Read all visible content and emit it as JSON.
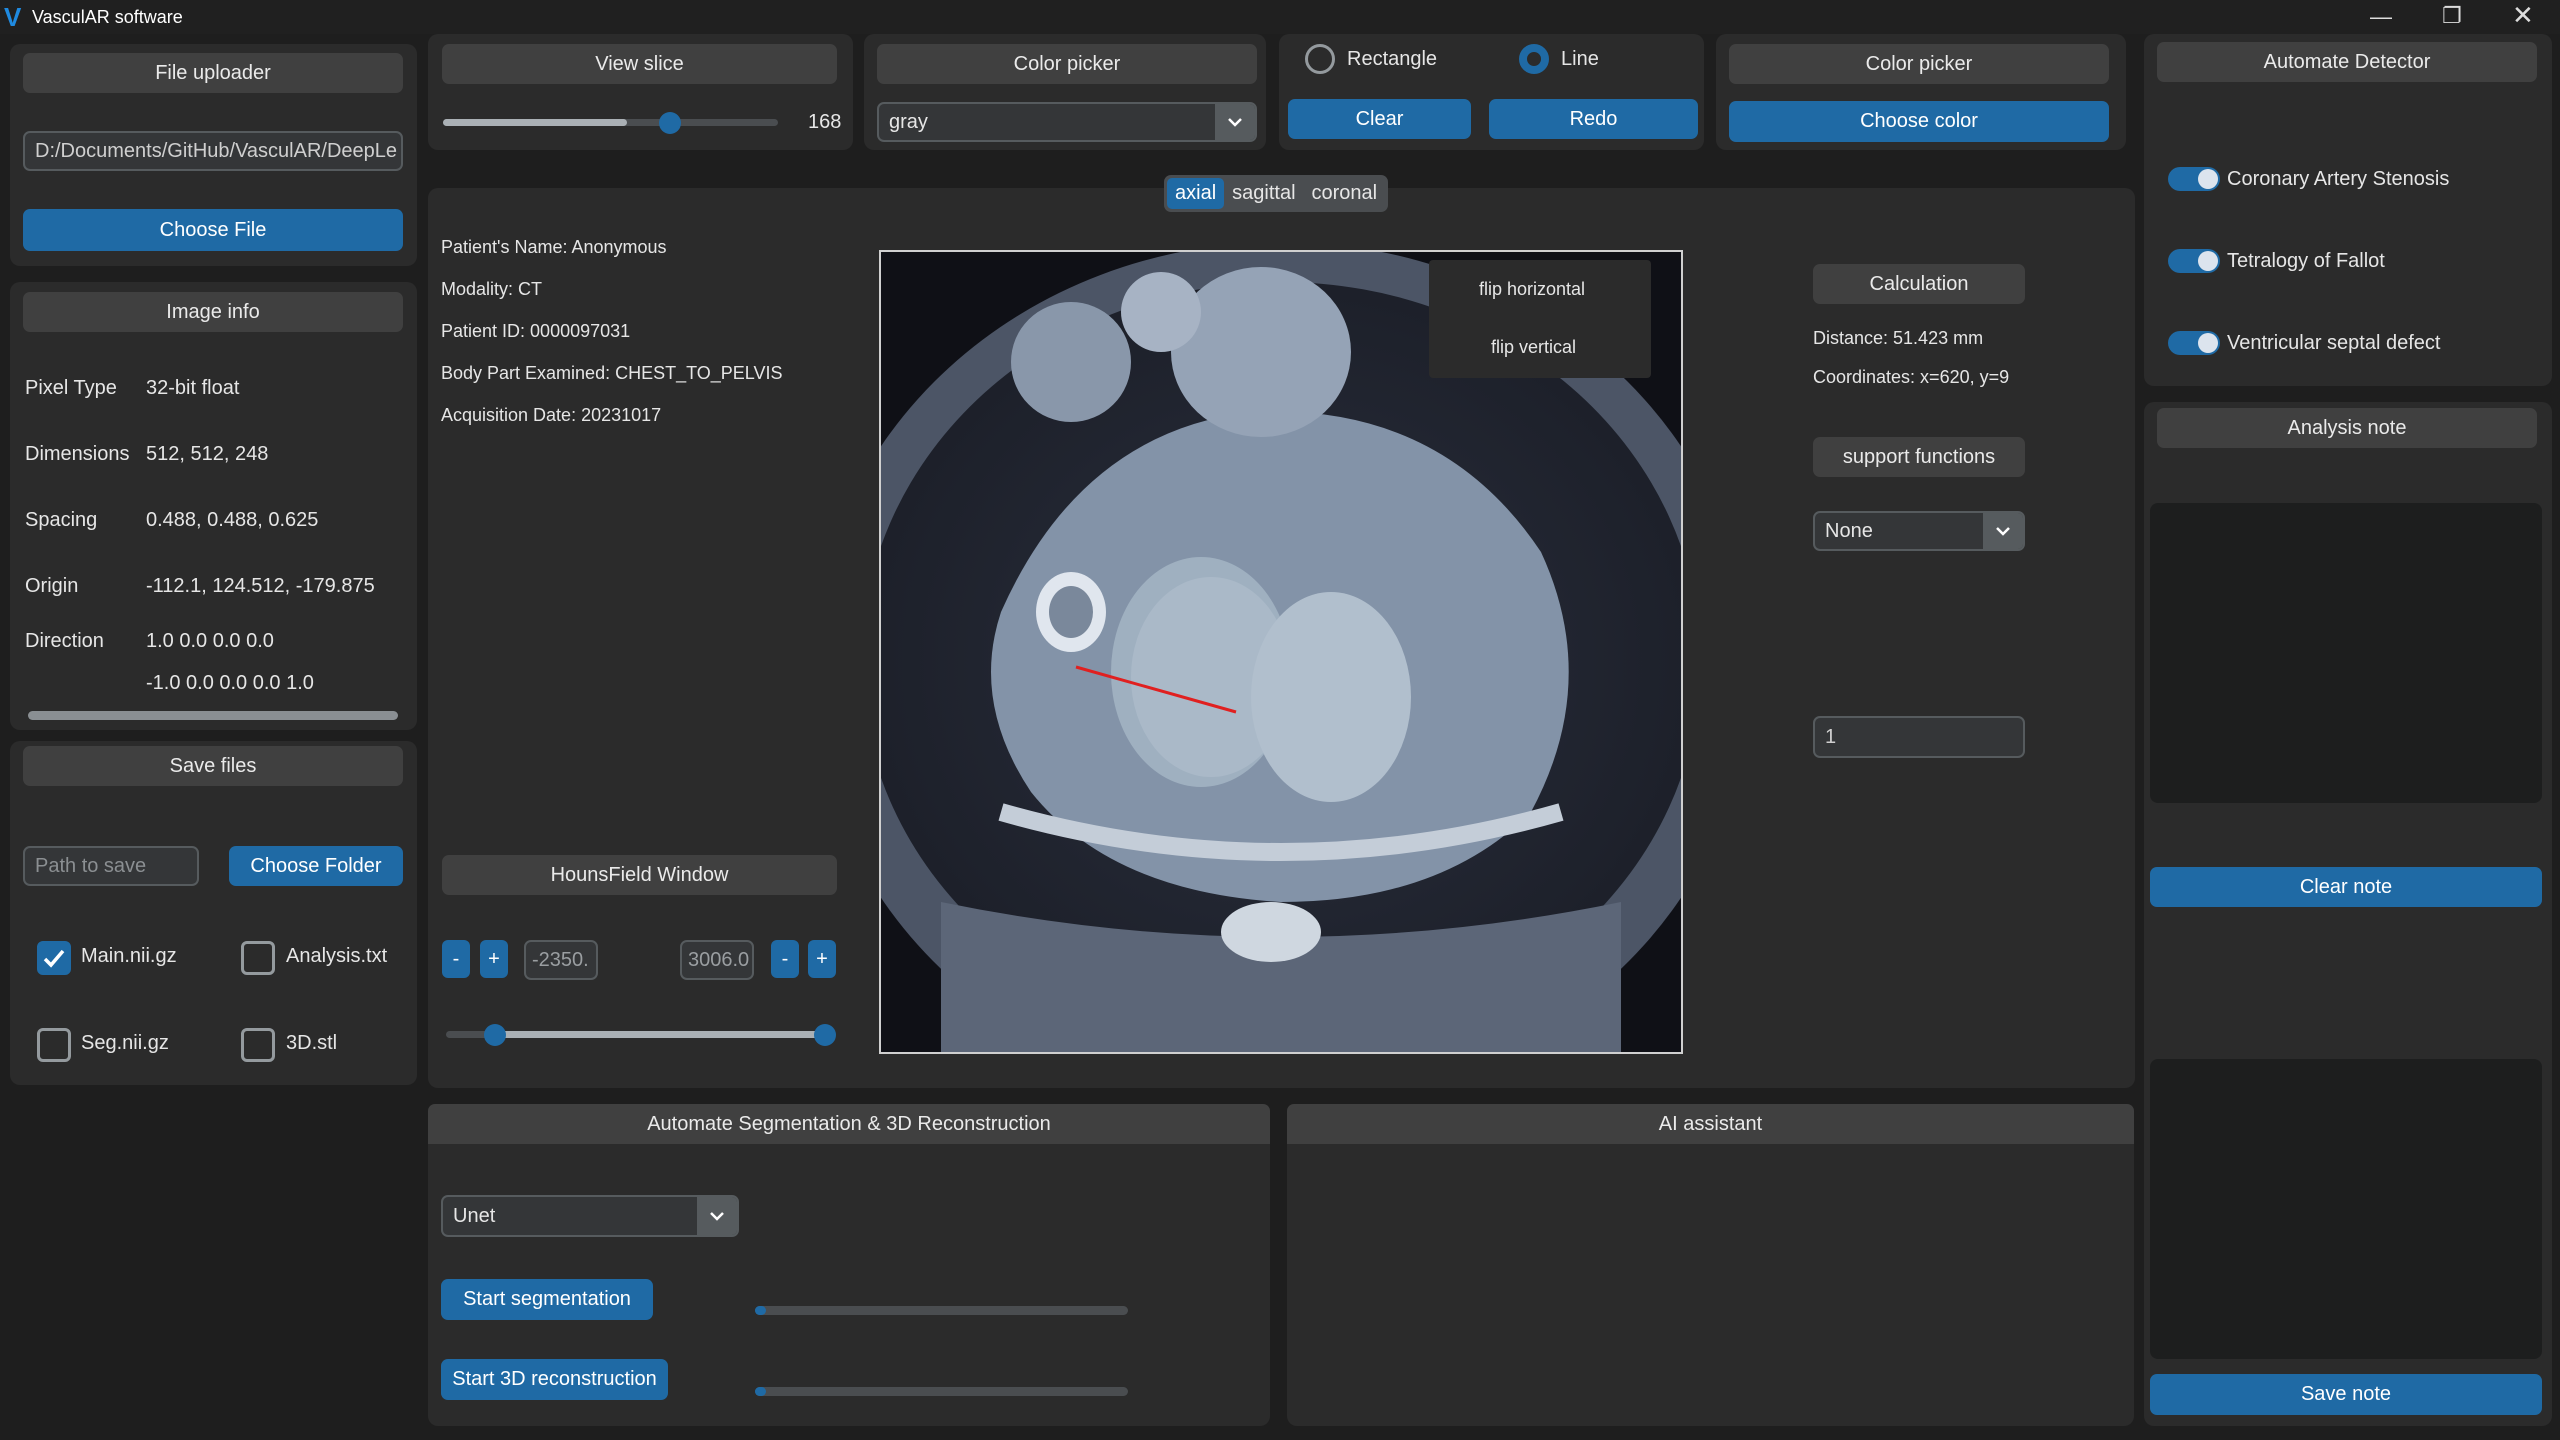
{
  "window": {
    "title": "VasculAR software"
  },
  "left": {
    "file_uploader": "File uploader",
    "path_value": "D:/Documents/GitHub/VasculAR/DeepLe",
    "choose_file": "Choose File",
    "image_info_header": "Image info",
    "info": [
      {
        "label": "Pixel Type",
        "value": "32-bit float"
      },
      {
        "label": "Dimensions",
        "value": "512,  512,  248"
      },
      {
        "label": "Spacing",
        "value": "0.488,  0.488,  0.625"
      },
      {
        "label": "Origin",
        "value": "-112.1,  124.512,  -179.875"
      },
      {
        "label": "Direction",
        "value": "1.0 0.0 0.0 0.0"
      }
    ],
    "direction_line2": "-1.0 0.0 0.0 0.0 1.0",
    "save_files": "Save files",
    "save_placeholder": "Path to save",
    "choose_folder": "Choose Folder",
    "checkboxes": [
      {
        "label": "Main.nii.gz",
        "checked": true
      },
      {
        "label": "Analysis.txt",
        "checked": false
      },
      {
        "label": "Seg.nii.gz",
        "checked": false
      },
      {
        "label": "3D.stl",
        "checked": false
      }
    ]
  },
  "toolbar": {
    "view_slice": "View slice",
    "slice_value": "168",
    "slice_fraction": 0.55,
    "color_picker_1": "Color picker",
    "colormap": "gray",
    "rect_label": "Rectangle",
    "line_label": "Line",
    "clear": "Clear",
    "redo": "Redo",
    "color_picker_2": "Color picker",
    "choose_color": "Choose color"
  },
  "viewer": {
    "views": [
      "axial",
      "sagittal",
      "coronal"
    ],
    "selected_view": "axial",
    "patient": [
      "Patient's Name:  Anonymous",
      "Modality: CT",
      "Patient ID: 0000097031",
      "Body Part Examined: CHEST_TO_PELVIS",
      "Acquisition Date: 20231017"
    ],
    "flip_horizontal": "flip horizontal",
    "flip_vertical": "flip vertical",
    "hounsfield": "HounsField Window",
    "hu_min": "-2350.",
    "hu_max": "3006.0",
    "minus": "-",
    "plus": "+",
    "calculation": "Calculation",
    "distance": "Distance: 51.423 mm",
    "coordinates": "Coordinates: x=620, y=9",
    "support_functions": "support functions",
    "support_value": "None",
    "number_value": "1"
  },
  "bottom": {
    "seg_header": "Automate Segmentation & 3D Reconstruction",
    "model": "Unet",
    "start_seg": "Start segmentation",
    "start_3d": "Start 3D reconstruction",
    "ai_header": "AI assistant"
  },
  "right": {
    "detector_header": "Automate Detector",
    "detectors": [
      "Coronary Artery Stenosis",
      "Tetralogy of Fallot",
      "Ventricular septal defect"
    ],
    "analysis_note": "Analysis note",
    "clear_note": "Clear note",
    "save_note": "Save note"
  },
  "colors": {
    "accent": "#1f6aa5",
    "panel": "#2b2b2b",
    "background": "#1e1e1e",
    "measure_line": "#e02020"
  }
}
